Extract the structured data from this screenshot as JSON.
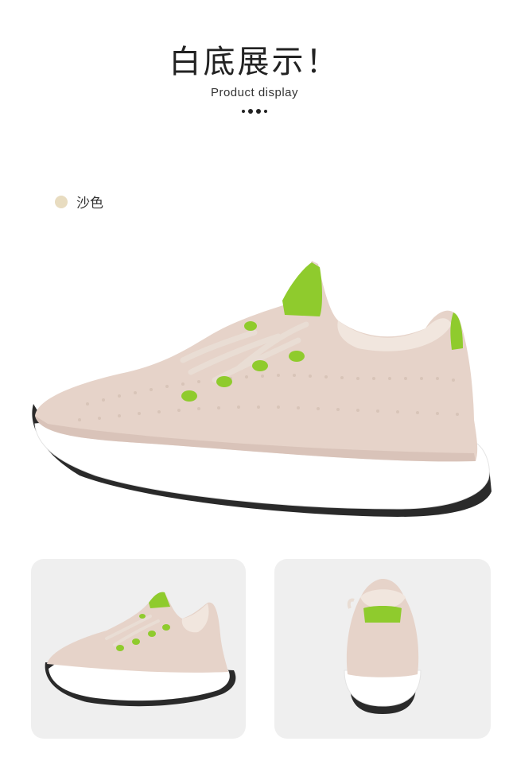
{
  "header": {
    "title": "白底展示！",
    "subtitle": "Product display"
  },
  "color_option": {
    "name": "沙色",
    "swatch_color": "#e8dcc0"
  },
  "colors": {
    "upper": "#e6d3c9",
    "upper_shadow": "#cdb7ab",
    "accent": "#8fcb2d",
    "sole": "#ffffff",
    "outsole": "#2a2a2a",
    "card_bg": "#efefef"
  },
  "images": {
    "hero": "side-view-icon",
    "card_left": "three-quarter-view-icon",
    "card_right": "rear-view-icon"
  }
}
